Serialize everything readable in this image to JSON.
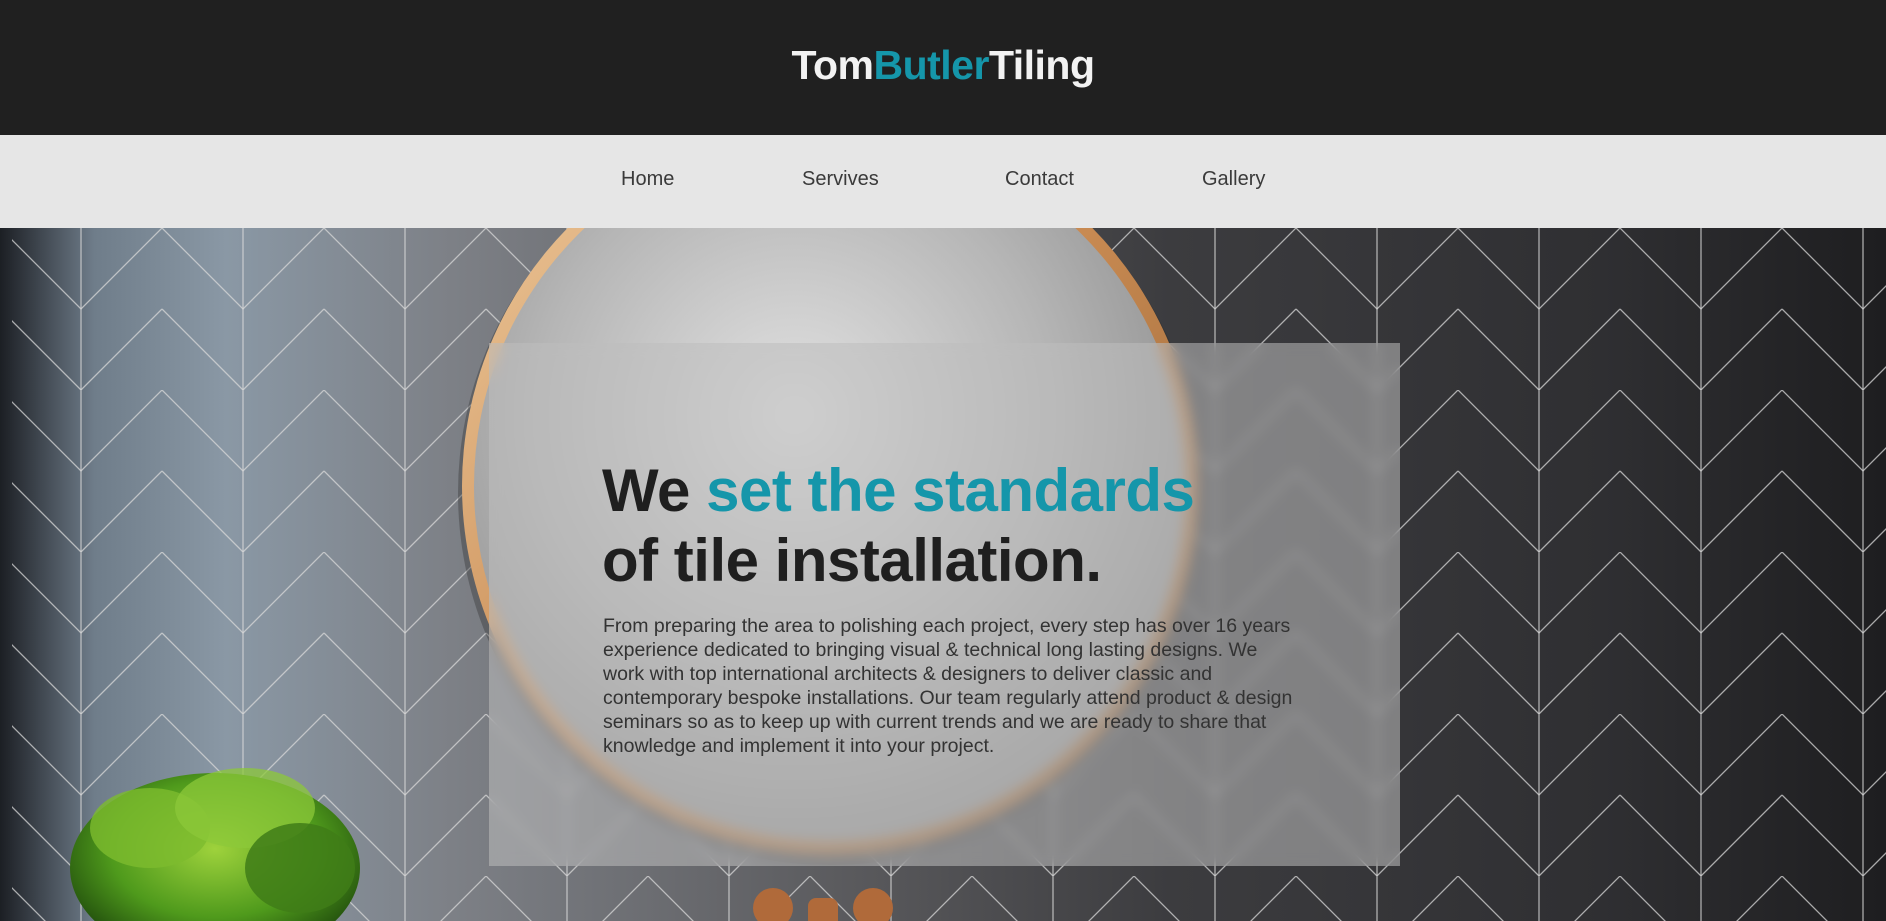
{
  "brand": {
    "part1": "Tom",
    "part2": "Butler",
    "part3": "Tiling",
    "accent_color": "#1596aa"
  },
  "nav": {
    "items": [
      {
        "label": "Home"
      },
      {
        "label": "Servives"
      },
      {
        "label": "Contact"
      },
      {
        "label": "Gallery"
      }
    ]
  },
  "hero": {
    "headline_word1": "We",
    "headline_accent": "set the standards",
    "headline_line2": "of tile installation.",
    "paragraph": "From preparing the area to polishing each project, every step has over 16 years experience dedicated to bringing visual & technical long lasting designs. We work with top international architects & designers to deliver classic and contemporary bespoke installations. Our team regularly attend product & design seminars so as to keep up with current trends and we are ready to share that knowledge and implement it into your project.",
    "background_image": "bathroom-tile-wall-with-round-mirror-and-plant"
  }
}
